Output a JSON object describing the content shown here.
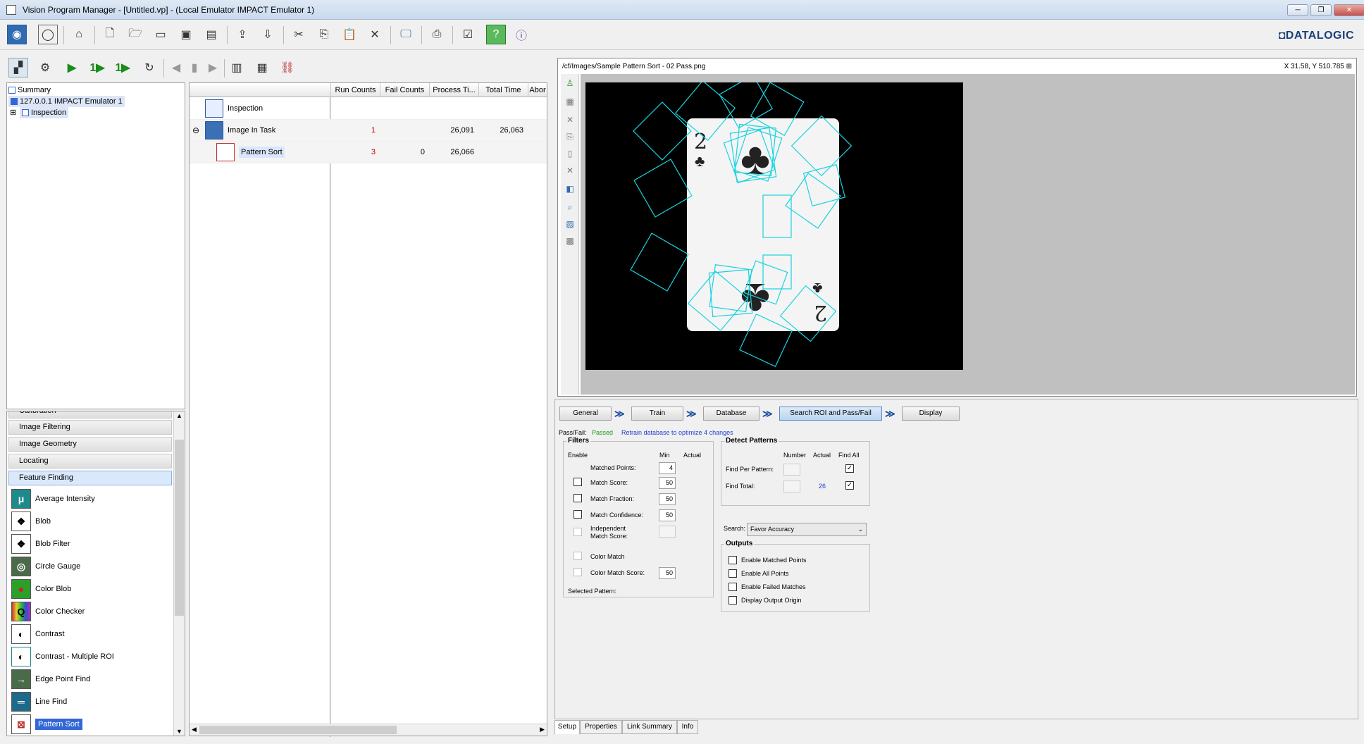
{
  "window": {
    "title": "Vision Program Manager - [Untitled.vp] - (Local Emulator IMPACT Emulator 1)",
    "min": "─",
    "restore": "❐",
    "close": "✕"
  },
  "brand": "◘DATALOGIC",
  "tree": {
    "summary": "Summary",
    "device": "127.0.0.1 IMPACT Emulator 1",
    "inspection": "Inspection",
    "expander": "⊞"
  },
  "palette": {
    "categories": [
      "Calibration",
      "Image Filtering",
      "Image Geometry",
      "Locating",
      "Feature Finding"
    ],
    "tools": [
      {
        "label": "Average Intensity",
        "glyph": "μ"
      },
      {
        "label": "Blob",
        "glyph": "❖"
      },
      {
        "label": "Blob Filter",
        "glyph": "❖"
      },
      {
        "label": "Circle Gauge",
        "glyph": "◎"
      },
      {
        "label": "Color Blob",
        "glyph": "●"
      },
      {
        "label": "Color Checker",
        "glyph": "Q"
      },
      {
        "label": "Contrast",
        "glyph": "◐"
      },
      {
        "label": "Contrast - Multiple ROI",
        "glyph": "◐"
      },
      {
        "label": "Edge Point Find",
        "glyph": "→"
      },
      {
        "label": "Line Find",
        "glyph": "═"
      },
      {
        "label": "Pattern Sort",
        "glyph": "⊠"
      }
    ],
    "scroll_up": "▲",
    "scroll_down": "▼"
  },
  "grid": {
    "headers": [
      "Run Counts",
      "Fail Counts",
      "Process Ti...",
      "Total Time",
      "Abor"
    ],
    "rows": [
      {
        "name": "Inspection",
        "run": "",
        "fail": "",
        "proc": "",
        "total": ""
      },
      {
        "name": "Image In Task",
        "run": "1",
        "fail": "",
        "proc": "26,091",
        "total": "26,063"
      },
      {
        "name": "Pattern Sort",
        "run": "3",
        "fail": "0",
        "proc": "26,066",
        "total": ""
      }
    ],
    "collapse": "⊖",
    "scroll_left": "◀",
    "scroll_right": "▶"
  },
  "image": {
    "path": "/cf/Images/Sample Pattern Sort - 02 Pass.png",
    "coord": "X 31.58,  Y 510.785",
    "pin": "⊞",
    "card_rank": "2",
    "card_suit": "♣"
  },
  "steps": [
    "General",
    "Train",
    "Database",
    "Search ROI and Pass/Fail",
    "Display"
  ],
  "step_arrow": "≫",
  "passfail": {
    "label": "Pass/Fail:",
    "status": "Passed",
    "note": "Retrain database to optimize 4 changes"
  },
  "filters": {
    "title": "Filters",
    "col_enable": "Enable",
    "col_min": "Min",
    "col_actual": "Actual",
    "matched_points": {
      "label": "Matched Points:",
      "value": "4"
    },
    "match_score": {
      "label": "Match Score:",
      "value": "50"
    },
    "match_fraction": {
      "label": "Match Fraction:",
      "value": "50"
    },
    "match_confidence": {
      "label": "Match Confidence:",
      "value": "50"
    },
    "independent": {
      "label1": "Independent",
      "label2": "Match Score:"
    },
    "color_match": {
      "label": "Color Match"
    },
    "color_match_score": {
      "label": "Color Match Score:",
      "value": "50"
    },
    "selected_pattern": "Selected Pattern:"
  },
  "detect": {
    "title": "Detect Patterns",
    "col_number": "Number",
    "col_actual": "Actual",
    "col_findall": "Find All",
    "find_per_pattern": "Find Per Pattern:",
    "find_total": "Find Total:",
    "find_total_actual": "26",
    "check": "✓"
  },
  "search": {
    "label": "Search:",
    "value": "Favor Accuracy",
    "arrow": "⌄"
  },
  "outputs": {
    "title": "Outputs",
    "items": [
      "Enable Matched Points",
      "Enable All Points",
      "Enable Failed Matches",
      "Display Output Origin"
    ]
  },
  "bottom_tabs": [
    "Setup",
    "Properties",
    "Link Summary",
    "Info"
  ],
  "colors": {
    "accent": "#3367d6",
    "pass": "#1a9a1a",
    "note": "#1a3fd0",
    "overlay": "#19d3e0"
  }
}
